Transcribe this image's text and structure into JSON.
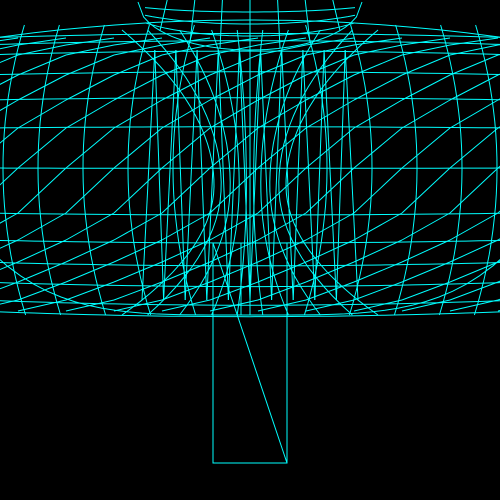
{
  "scene": {
    "background": "#000000",
    "wire_color": "#00ffff",
    "objects": [
      "torus-wireframe",
      "hyperboloid-wireframe",
      "sphere-cap-wireframe",
      "box-wireframe"
    ]
  }
}
